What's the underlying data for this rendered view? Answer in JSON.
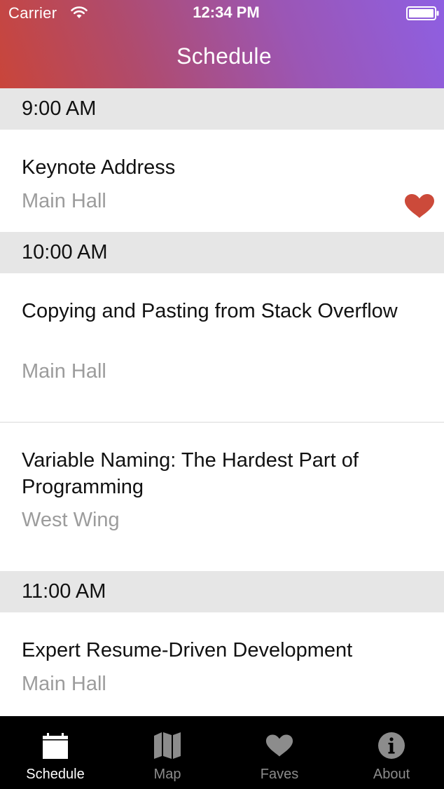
{
  "status_bar": {
    "carrier": "Carrier",
    "time": "12:34 PM"
  },
  "nav": {
    "title": "Schedule"
  },
  "sections": [
    {
      "time": "9:00 AM",
      "sessions": [
        {
          "title": "Keynote Address",
          "location": "Main Hall",
          "favorite": true
        }
      ]
    },
    {
      "time": "10:00 AM",
      "sessions": [
        {
          "title": "Copying and Pasting from Stack Overflow",
          "location": "Main Hall",
          "favorite": false
        },
        {
          "title": "Variable Naming: The Hardest Part of Programming",
          "location": "West Wing",
          "favorite": false
        }
      ]
    },
    {
      "time": "11:00 AM",
      "sessions": [
        {
          "title": "Expert Resume-Driven Development",
          "location": "Main Hall",
          "favorite": false
        }
      ]
    }
  ],
  "tabs": [
    {
      "label": "Schedule",
      "icon": "calendar-icon",
      "active": true
    },
    {
      "label": "Map",
      "icon": "map-icon",
      "active": false
    },
    {
      "label": "Faves",
      "icon": "heart-icon",
      "active": false
    },
    {
      "label": "About",
      "icon": "info-icon",
      "active": false
    }
  ],
  "colors": {
    "favorite": "#cc4a3a",
    "section_background": "#e6e6e6",
    "secondary_text": "#9c9c9c",
    "tab_active": "#ffffff",
    "tab_inactive": "#8c8c8c"
  }
}
